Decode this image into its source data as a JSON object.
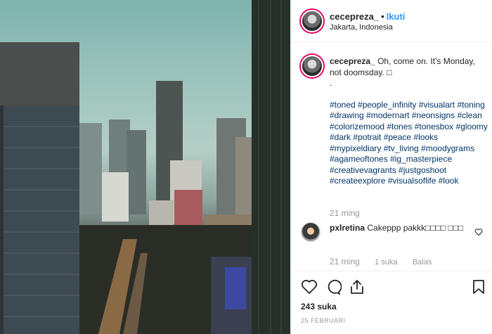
{
  "post": {
    "username": "cecepreza_",
    "follow_label": "Ikuti",
    "location": "Jakarta, Indonesia",
    "caption_user": "cecepreza_",
    "caption_text": "Oh, come on. It's Monday, not doomsday. □",
    "caption_dot": ".",
    "hashtags": "#toned #people_infinity #visualart #toning #drawing #modernart #neonsigns #clean #colorizemood #tones #tonesbox #gloomy #dark #potrait #peace #looks #mypixeldiary #tv_living #moodygrams #agameoftones #ig_masterpiece #creativevagrants #justgoshoot #createexplore #visualsoflife #look",
    "caption_time": "21 ming",
    "likes": "243 suka",
    "date": "25 FEBRUARI"
  },
  "reply": {
    "username": "pxlretina",
    "text": "Cakeppp pakkk□□□□ □□□",
    "time": "21 ming",
    "likes": "1 suka",
    "reply_label": "Balas"
  },
  "icons": {
    "more": "more-options-icon",
    "heart": "heart-icon",
    "comment": "comment-icon",
    "share": "share-icon",
    "bookmark": "bookmark-icon"
  },
  "colors": {
    "link": "#3897f0",
    "hashtag": "#003569",
    "muted": "#999999",
    "avatar_ring": "#e6005c"
  }
}
